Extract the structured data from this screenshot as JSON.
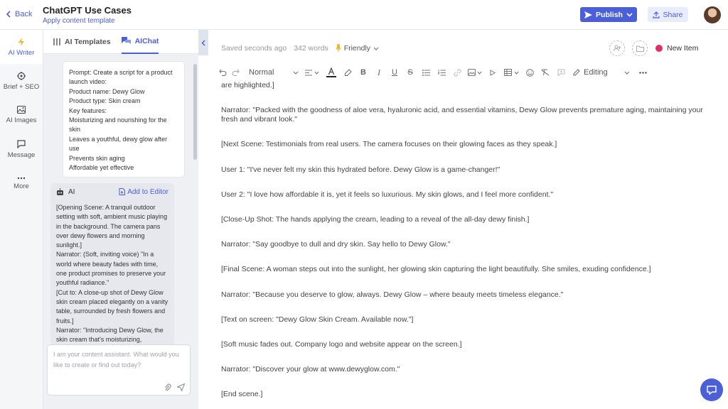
{
  "header": {
    "back_label": "Back",
    "title": "ChatGPT Use Cases",
    "subtitle": "Apply content template",
    "publish_label": "Publish",
    "share_label": "Share"
  },
  "nav": {
    "items": [
      {
        "label": "AI Writer",
        "icon": "lightning-icon",
        "active": true
      },
      {
        "label": "Brief + SEO",
        "icon": "target-icon",
        "active": false
      },
      {
        "label": "AI Images",
        "icon": "image-icon",
        "active": false
      },
      {
        "label": "Message",
        "icon": "message-icon",
        "active": false
      },
      {
        "label": "More",
        "icon": "more-icon",
        "active": false
      }
    ]
  },
  "chat": {
    "tabs": [
      {
        "label": "AI Templates",
        "active": false
      },
      {
        "label": "AIChat",
        "active": true
      }
    ],
    "prompt": "Prompt: Create a script for a product launch video:\nProduct name: Dewy Glow\nProduct type: Skin cream\nKey features:\nMoisturizing and nourishing for the skin\nLeaves a youthful, dewy glow after use\nPrevents skin aging\nAffordable yet effective",
    "ai_label": "AI",
    "add_to_editor": "Add to Editor",
    "ai_response": "[Opening Scene: A tranquil outdoor setting with soft, ambient music playing in the background. The camera pans over dewy flowers and morning sunlight.]\nNarrator: (Soft, inviting voice) \"In a world where beauty fades with time, one product promises to preserve your youthful radiance.\"\n[Cut to: A close-up shot of Dewy Glow skin cream placed elegantly on a vanity table, surrounded by fresh flowers and fruits.]\nNarrator: \"Introducing Dewy Glow, the skin cream that's moisturizing,",
    "input_placeholder": "I am your content assistant. What would you like to create or find out today?"
  },
  "editor": {
    "status": "Saved seconds ago",
    "word_count": "342 words",
    "tone": "Friendly",
    "new_item": "New Item",
    "style_select": "Normal",
    "mode_select": "Editing",
    "paragraphs": [
      "are highlighted.]",
      "Narrator: \"Packed with the goodness of aloe vera, hyaluronic acid, and essential vitamins, Dewy Glow prevents premature aging, maintaining your fresh and vibrant look.\"",
      "[Next Scene: Testimonials from real users. The camera focuses on their glowing faces as they speak.]",
      "User 1: \"I've never felt my skin this hydrated before. Dewy Glow is a game-changer!\"",
      "User 2: \"I love how affordable it is, yet it feels so luxurious. My skin glows, and I feel more confident.\"",
      "[Close-Up Shot: The hands applying the cream, leading to a reveal of the all-day dewy finish.]",
      "Narrator: \"Say goodbye to dull and dry skin. Say hello to Dewy Glow.\"",
      "[Final Scene: A woman steps out into the sunlight, her glowing skin capturing the light beautifully. She smiles, exuding confidence.]",
      "Narrator: \"Because you deserve to glow, always. Dewy Glow – where beauty meets timeless elegance.\"",
      "[Text on screen: \"Dewy Glow Skin Cream. Available now.\"]",
      "[Soft music fades out. Company logo and website appear on the screen.]",
      "Narrator: \"Discover your glow at www.dewyglow.com.\"",
      "[End scene.]"
    ]
  },
  "colors": {
    "accent": "#4a5fd8",
    "new_item_dot": "#e03060"
  }
}
